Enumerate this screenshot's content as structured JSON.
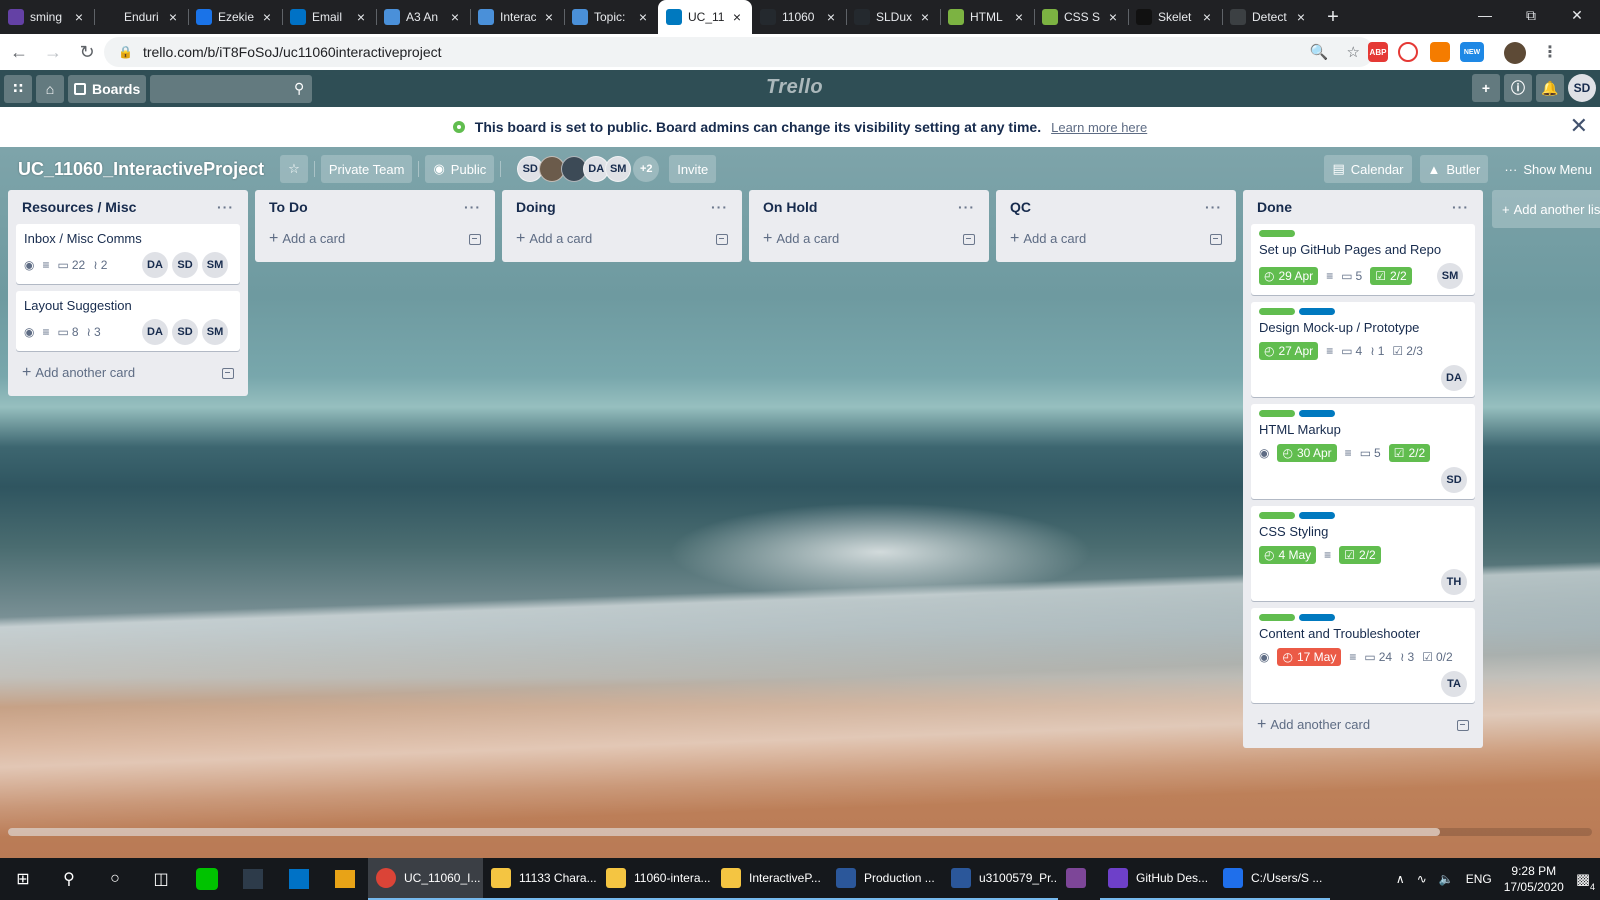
{
  "browser": {
    "tabs": [
      {
        "title": "sming",
        "favicon": "purple-mail-icon",
        "color": "#6441a5"
      },
      {
        "title": "Enduri",
        "favicon": "face-icon",
        "color": "#202124"
      },
      {
        "title": "Ezekie",
        "favicon": "doc-icon",
        "color": "#1a73e8"
      },
      {
        "title": "Email",
        "favicon": "outlook-icon",
        "color": "#0072c6"
      },
      {
        "title": "A3 An",
        "favicon": "gear-blue-icon",
        "color": "#4a90d9"
      },
      {
        "title": "Interac",
        "favicon": "gear-blue-icon",
        "color": "#4a90d9"
      },
      {
        "title": "Topic:",
        "favicon": "gear-blue-icon",
        "color": "#4a90d9"
      },
      {
        "title": "UC_11",
        "favicon": "trello-icon",
        "color": "#0079bf",
        "active": true
      },
      {
        "title": "11060",
        "favicon": "github-icon",
        "color": "#24292e"
      },
      {
        "title": "SLDux",
        "favicon": "github-icon",
        "color": "#24292e"
      },
      {
        "title": "HTML",
        "favicon": "chart-green-icon",
        "color": "#7cb342"
      },
      {
        "title": "CSS Sl",
        "favicon": "chart-green-icon",
        "color": "#7cb342"
      },
      {
        "title": "Skelet",
        "favicon": "s-icon",
        "color": "#111111"
      },
      {
        "title": "Detect",
        "favicon": "circle-icon",
        "color": "#3c4043"
      }
    ],
    "url": "trello.com/b/iT8FoSoJ/uc11060interactiveproject"
  },
  "header": {
    "boards_label": "Boards",
    "logo_text": "Trello",
    "user_initials": "SD"
  },
  "banner": {
    "message": "This board is set to public. Board admins can change its visibility setting at any time.",
    "link": "Learn more here"
  },
  "board": {
    "title": "UC_11060_InteractiveProject",
    "team": "Private Team",
    "visibility": "Public",
    "members": [
      "SD",
      "",
      "",
      "DA",
      "SM"
    ],
    "more_members": "+2",
    "invite": "Invite",
    "calendar": "Calendar",
    "butler": "Butler",
    "show_menu": "Show Menu",
    "add_list": "Add another list"
  },
  "lists": [
    {
      "name": "Resources / Misc",
      "add_label": "Add another card",
      "cards": [
        {
          "title": "Inbox / Misc Comms",
          "watch": true,
          "desc": true,
          "comments": "22",
          "attachments": "2",
          "members": [
            "DA",
            "SD",
            "SM"
          ]
        },
        {
          "title": "Layout Suggestion",
          "watch": true,
          "desc": true,
          "comments": "8",
          "attachments": "3",
          "members": [
            "DA",
            "SD",
            "SM"
          ]
        }
      ]
    },
    {
      "name": "To Do",
      "add_label": "Add a card",
      "cards": []
    },
    {
      "name": "Doing",
      "add_label": "Add a card",
      "cards": []
    },
    {
      "name": "On Hold",
      "add_label": "Add a card",
      "cards": []
    },
    {
      "name": "QC",
      "add_label": "Add a card",
      "cards": []
    },
    {
      "name": "Done",
      "add_label": "Add another card",
      "cards": [
        {
          "title": "Set up GitHub Pages and Repo",
          "labels": [
            "#61bd4f"
          ],
          "due": "29 Apr",
          "desc": true,
          "comments": "5",
          "checklist": "2/2",
          "checklist_done": true,
          "members": [
            "SM"
          ]
        },
        {
          "title": "Design Mock-up / Prototype",
          "labels": [
            "#61bd4f",
            "#0079bf"
          ],
          "due": "27 Apr",
          "desc": true,
          "comments": "4",
          "attachments": "1",
          "checklist": "2/3",
          "members": [
            "DA"
          ]
        },
        {
          "title": "HTML Markup",
          "labels": [
            "#61bd4f",
            "#0079bf"
          ],
          "watch": true,
          "due": "30 Apr",
          "desc": true,
          "comments": "5",
          "checklist": "2/2",
          "checklist_done": true,
          "members": [
            "SD"
          ]
        },
        {
          "title": "CSS Styling",
          "labels": [
            "#61bd4f",
            "#0079bf"
          ],
          "due": "4 May",
          "desc": true,
          "checklist": "2/2",
          "checklist_done": true,
          "members": [
            "TH"
          ]
        },
        {
          "title": "Content and Troubleshooter",
          "labels": [
            "#61bd4f",
            "#0079bf"
          ],
          "watch": true,
          "due": "17 May",
          "overdue": true,
          "desc": true,
          "comments": "24",
          "attachments": "3",
          "checklist": "0/2",
          "members": [
            "TA"
          ]
        }
      ]
    }
  ],
  "taskbar": {
    "apps": [
      {
        "label": "UC_11060_I...",
        "icon": "chrome-icon",
        "color": "#db4437",
        "active": true
      },
      {
        "label": "11133 Chara...",
        "icon": "folder-icon",
        "color": "#f4c542"
      },
      {
        "label": "11060-intera...",
        "icon": "folder-icon",
        "color": "#f4c542"
      },
      {
        "label": "InteractiveP...",
        "icon": "folder-icon",
        "color": "#f4c542"
      },
      {
        "label": "Production ...",
        "icon": "word-icon",
        "color": "#2b579a"
      },
      {
        "label": "u3100579_Pr...",
        "icon": "word-icon",
        "color": "#2b579a"
      },
      {
        "label": "",
        "icon": "tor-icon",
        "color": "#7d4698"
      },
      {
        "label": "GitHub Des...",
        "icon": "github-desktop-icon",
        "color": "#6e40c9"
      },
      {
        "label": "C:/Users/S ...",
        "icon": "terminal-icon",
        "color": "#1f6feb"
      }
    ],
    "language": "ENG",
    "time": "9:28 PM",
    "date": "17/05/2020",
    "notification_count": "4"
  }
}
